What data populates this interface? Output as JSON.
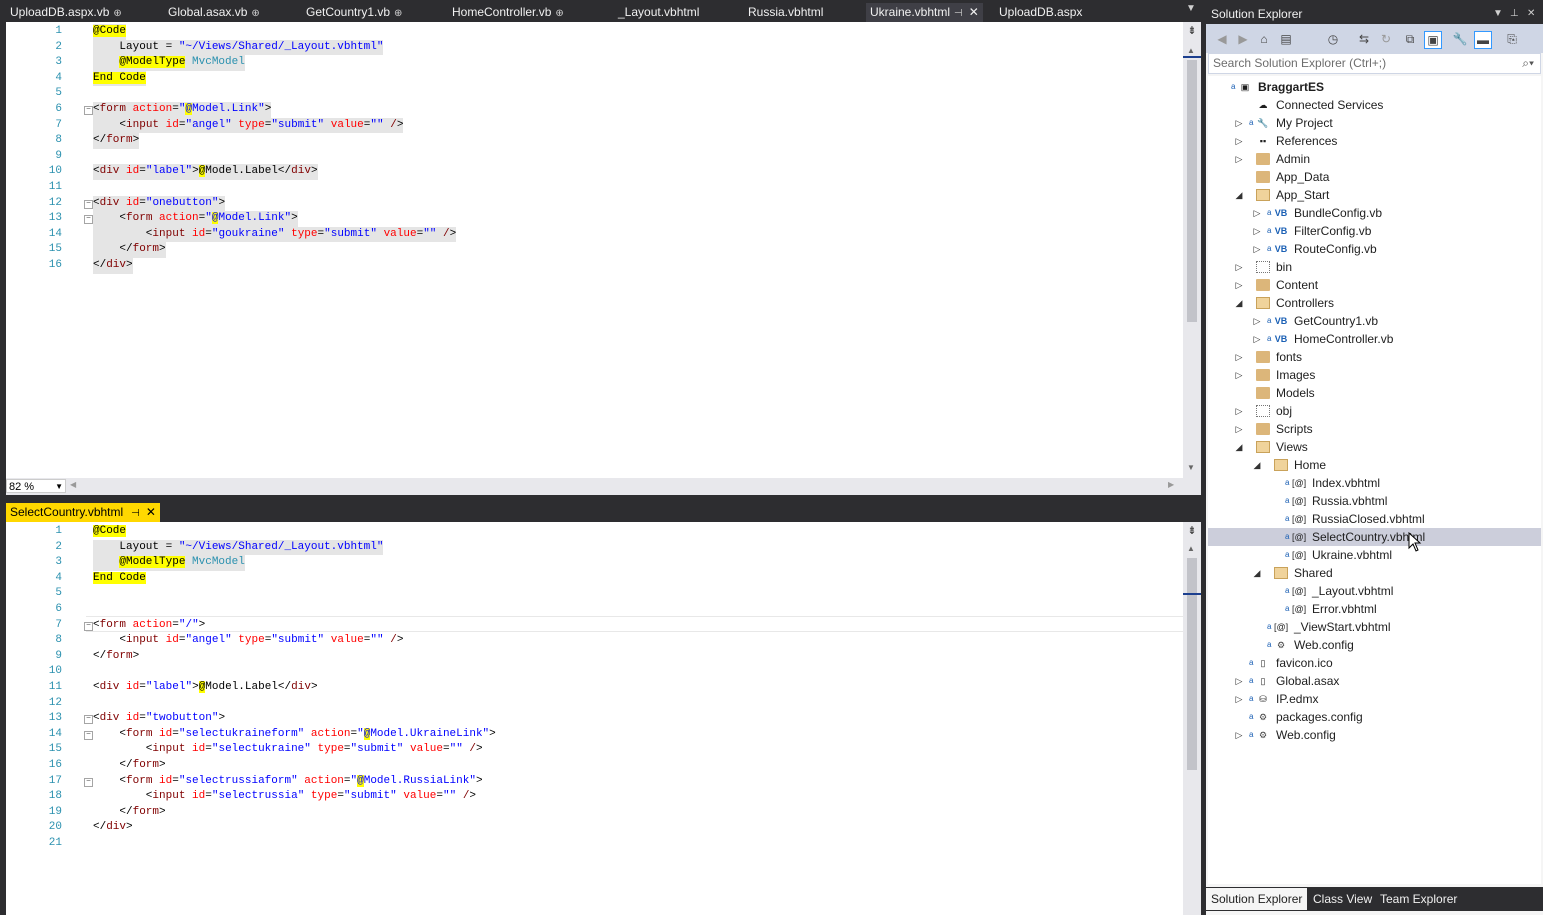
{
  "top_tabs": [
    {
      "label": "UploadDB.aspx.vb",
      "pinned": true
    },
    {
      "label": "Global.asax.vb",
      "pinned": true
    },
    {
      "label": "GetCountry1.vb",
      "pinned": true
    },
    {
      "label": "HomeController.vb",
      "pinned": true
    },
    {
      "label": "_Layout.vbhtml",
      "pinned": false
    },
    {
      "label": "Russia.vbhtml",
      "pinned": false
    },
    {
      "label": "Ukraine.vbhtml",
      "pinned": true,
      "active": true
    },
    {
      "label": "UploadDB.aspx",
      "pinned": false
    }
  ],
  "zoom": {
    "value": "82 %"
  },
  "bottom_tab": {
    "label": "SelectCountry.vbhtml"
  },
  "top_editor": {
    "lines": [
      {
        "n": "1",
        "text": "@Code"
      },
      {
        "n": "2",
        "text": "    Layout = \"~/Views/Shared/_Layout.vbhtml\""
      },
      {
        "n": "3",
        "text": "    @ModelType MvcModel"
      },
      {
        "n": "4",
        "text": "End Code"
      },
      {
        "n": "5",
        "text": ""
      },
      {
        "n": "6",
        "text": "<form action=\"@Model.Link\">"
      },
      {
        "n": "7",
        "text": "    <input id=\"angel\" type=\"submit\" value=\"\" />"
      },
      {
        "n": "8",
        "text": "</form>"
      },
      {
        "n": "9",
        "text": ""
      },
      {
        "n": "10",
        "text": "<div id=\"label\">@Model.Label</div>"
      },
      {
        "n": "11",
        "text": ""
      },
      {
        "n": "12",
        "text": "<div id=\"onebutton\">"
      },
      {
        "n": "13",
        "text": "    <form action=\"@Model.Link\">"
      },
      {
        "n": "14",
        "text": "        <input id=\"goukraine\" type=\"submit\" value=\"\" />"
      },
      {
        "n": "15",
        "text": "    </form>"
      },
      {
        "n": "16",
        "text": "</div>"
      }
    ]
  },
  "bottom_editor": {
    "lines": [
      {
        "n": "1",
        "text": "@Code"
      },
      {
        "n": "2",
        "text": "    Layout = \"~/Views/Shared/_Layout.vbhtml\""
      },
      {
        "n": "3",
        "text": "    @ModelType MvcModel"
      },
      {
        "n": "4",
        "text": "End Code"
      },
      {
        "n": "5",
        "text": ""
      },
      {
        "n": "6",
        "text": ""
      },
      {
        "n": "7",
        "text": "<form action=\"/\">"
      },
      {
        "n": "8",
        "text": "    <input id=\"angel\" type=\"submit\" value=\"\" />"
      },
      {
        "n": "9",
        "text": "</form>"
      },
      {
        "n": "10",
        "text": ""
      },
      {
        "n": "11",
        "text": "<div id=\"label\">@Model.Label</div>"
      },
      {
        "n": "12",
        "text": ""
      },
      {
        "n": "13",
        "text": "<div id=\"twobutton\">"
      },
      {
        "n": "14",
        "text": "    <form id=\"selectukraineform\" action=\"@Model.UkraineLink\">"
      },
      {
        "n": "15",
        "text": "        <input id=\"selectukraine\" type=\"submit\" value=\"\" />"
      },
      {
        "n": "16",
        "text": "    </form>"
      },
      {
        "n": "17",
        "text": "    <form id=\"selectrussiaform\" action=\"@Model.RussiaLink\">"
      },
      {
        "n": "18",
        "text": "        <input id=\"selectrussia\" type=\"submit\" value=\"\" />"
      },
      {
        "n": "19",
        "text": "    </form>"
      },
      {
        "n": "20",
        "text": "</div>"
      },
      {
        "n": "21",
        "text": ""
      }
    ]
  },
  "solution_explorer": {
    "title": "Solution Explorer",
    "search_placeholder": "Search Solution Explorer (Ctrl+;)",
    "tree": [
      {
        "label": "BraggartES",
        "depth": 0,
        "exp": "",
        "icon": "project",
        "bold": true,
        "lock": true
      },
      {
        "label": "Connected Services",
        "depth": 1,
        "exp": "",
        "icon": "connected-services"
      },
      {
        "label": "My Project",
        "depth": 1,
        "exp": "▷",
        "icon": "wrench",
        "lock": true
      },
      {
        "label": "References",
        "depth": 1,
        "exp": "▷",
        "icon": "references"
      },
      {
        "label": "Admin",
        "depth": 1,
        "exp": "▷",
        "icon": "folder"
      },
      {
        "label": "App_Data",
        "depth": 1,
        "exp": "",
        "icon": "folder"
      },
      {
        "label": "App_Start",
        "depth": 1,
        "exp": "◢",
        "icon": "folder-open"
      },
      {
        "label": "BundleConfig.vb",
        "depth": 2,
        "exp": "▷",
        "icon": "vb",
        "lock": true
      },
      {
        "label": "FilterConfig.vb",
        "depth": 2,
        "exp": "▷",
        "icon": "vb",
        "lock": true
      },
      {
        "label": "RouteConfig.vb",
        "depth": 2,
        "exp": "▷",
        "icon": "vb",
        "lock": true
      },
      {
        "label": "bin",
        "depth": 1,
        "exp": "▷",
        "icon": "dotted"
      },
      {
        "label": "Content",
        "depth": 1,
        "exp": "▷",
        "icon": "folder"
      },
      {
        "label": "Controllers",
        "depth": 1,
        "exp": "◢",
        "icon": "folder-open"
      },
      {
        "label": "GetCountry1.vb",
        "depth": 2,
        "exp": "▷",
        "icon": "vb",
        "lock": true
      },
      {
        "label": "HomeController.vb",
        "depth": 2,
        "exp": "▷",
        "icon": "vb",
        "lock": true
      },
      {
        "label": "fonts",
        "depth": 1,
        "exp": "▷",
        "icon": "folder"
      },
      {
        "label": "Images",
        "depth": 1,
        "exp": "▷",
        "icon": "folder"
      },
      {
        "label": "Models",
        "depth": 1,
        "exp": "",
        "icon": "folder"
      },
      {
        "label": "obj",
        "depth": 1,
        "exp": "▷",
        "icon": "dotted"
      },
      {
        "label": "Scripts",
        "depth": 1,
        "exp": "▷",
        "icon": "folder"
      },
      {
        "label": "Views",
        "depth": 1,
        "exp": "◢",
        "icon": "folder-open"
      },
      {
        "label": "Home",
        "depth": 2,
        "exp": "◢",
        "icon": "folder-open"
      },
      {
        "label": "Index.vbhtml",
        "depth": 3,
        "exp": "",
        "icon": "razor",
        "lock": true
      },
      {
        "label": "Russia.vbhtml",
        "depth": 3,
        "exp": "",
        "icon": "razor",
        "lock": true
      },
      {
        "label": "RussiaClosed.vbhtml",
        "depth": 3,
        "exp": "",
        "icon": "razor",
        "lock": true
      },
      {
        "label": "SelectCountry.vbhtml",
        "depth": 3,
        "exp": "",
        "icon": "razor",
        "lock": true,
        "selected": true
      },
      {
        "label": "Ukraine.vbhtml",
        "depth": 3,
        "exp": "",
        "icon": "razor",
        "lock": true
      },
      {
        "label": "Shared",
        "depth": 2,
        "exp": "◢",
        "icon": "folder-open"
      },
      {
        "label": "_Layout.vbhtml",
        "depth": 3,
        "exp": "",
        "icon": "razor",
        "lock": true
      },
      {
        "label": "Error.vbhtml",
        "depth": 3,
        "exp": "",
        "icon": "razor",
        "lock": true
      },
      {
        "label": "_ViewStart.vbhtml",
        "depth": 2,
        "exp": "",
        "icon": "razor",
        "lock": true
      },
      {
        "label": "Web.config",
        "depth": 2,
        "exp": "",
        "icon": "config",
        "lock": true
      },
      {
        "label": "favicon.ico",
        "depth": 1,
        "exp": "",
        "icon": "file",
        "lock": true
      },
      {
        "label": "Global.asax",
        "depth": 1,
        "exp": "▷",
        "icon": "file",
        "lock": true
      },
      {
        "label": "IP.edmx",
        "depth": 1,
        "exp": "▷",
        "icon": "edmx",
        "lock": true
      },
      {
        "label": "packages.config",
        "depth": 1,
        "exp": "",
        "icon": "config",
        "lock": true
      },
      {
        "label": "Web.config",
        "depth": 1,
        "exp": "▷",
        "icon": "config",
        "lock": true
      }
    ],
    "bottom_tabs": [
      {
        "label": "Solution Explorer",
        "active": true
      },
      {
        "label": "Class View",
        "active": false
      },
      {
        "label": "Team Explorer",
        "active": false
      }
    ]
  },
  "colors": {
    "chrome_dark": "#2d2d30",
    "razor_highlight": "#ffff00",
    "tag": "#800000",
    "attribute": "#ff0000",
    "attribute_value": "#0000ff",
    "line_number": "#2b91af",
    "selected_row": "#cccedb",
    "bottom_tab": "#ffd800"
  }
}
